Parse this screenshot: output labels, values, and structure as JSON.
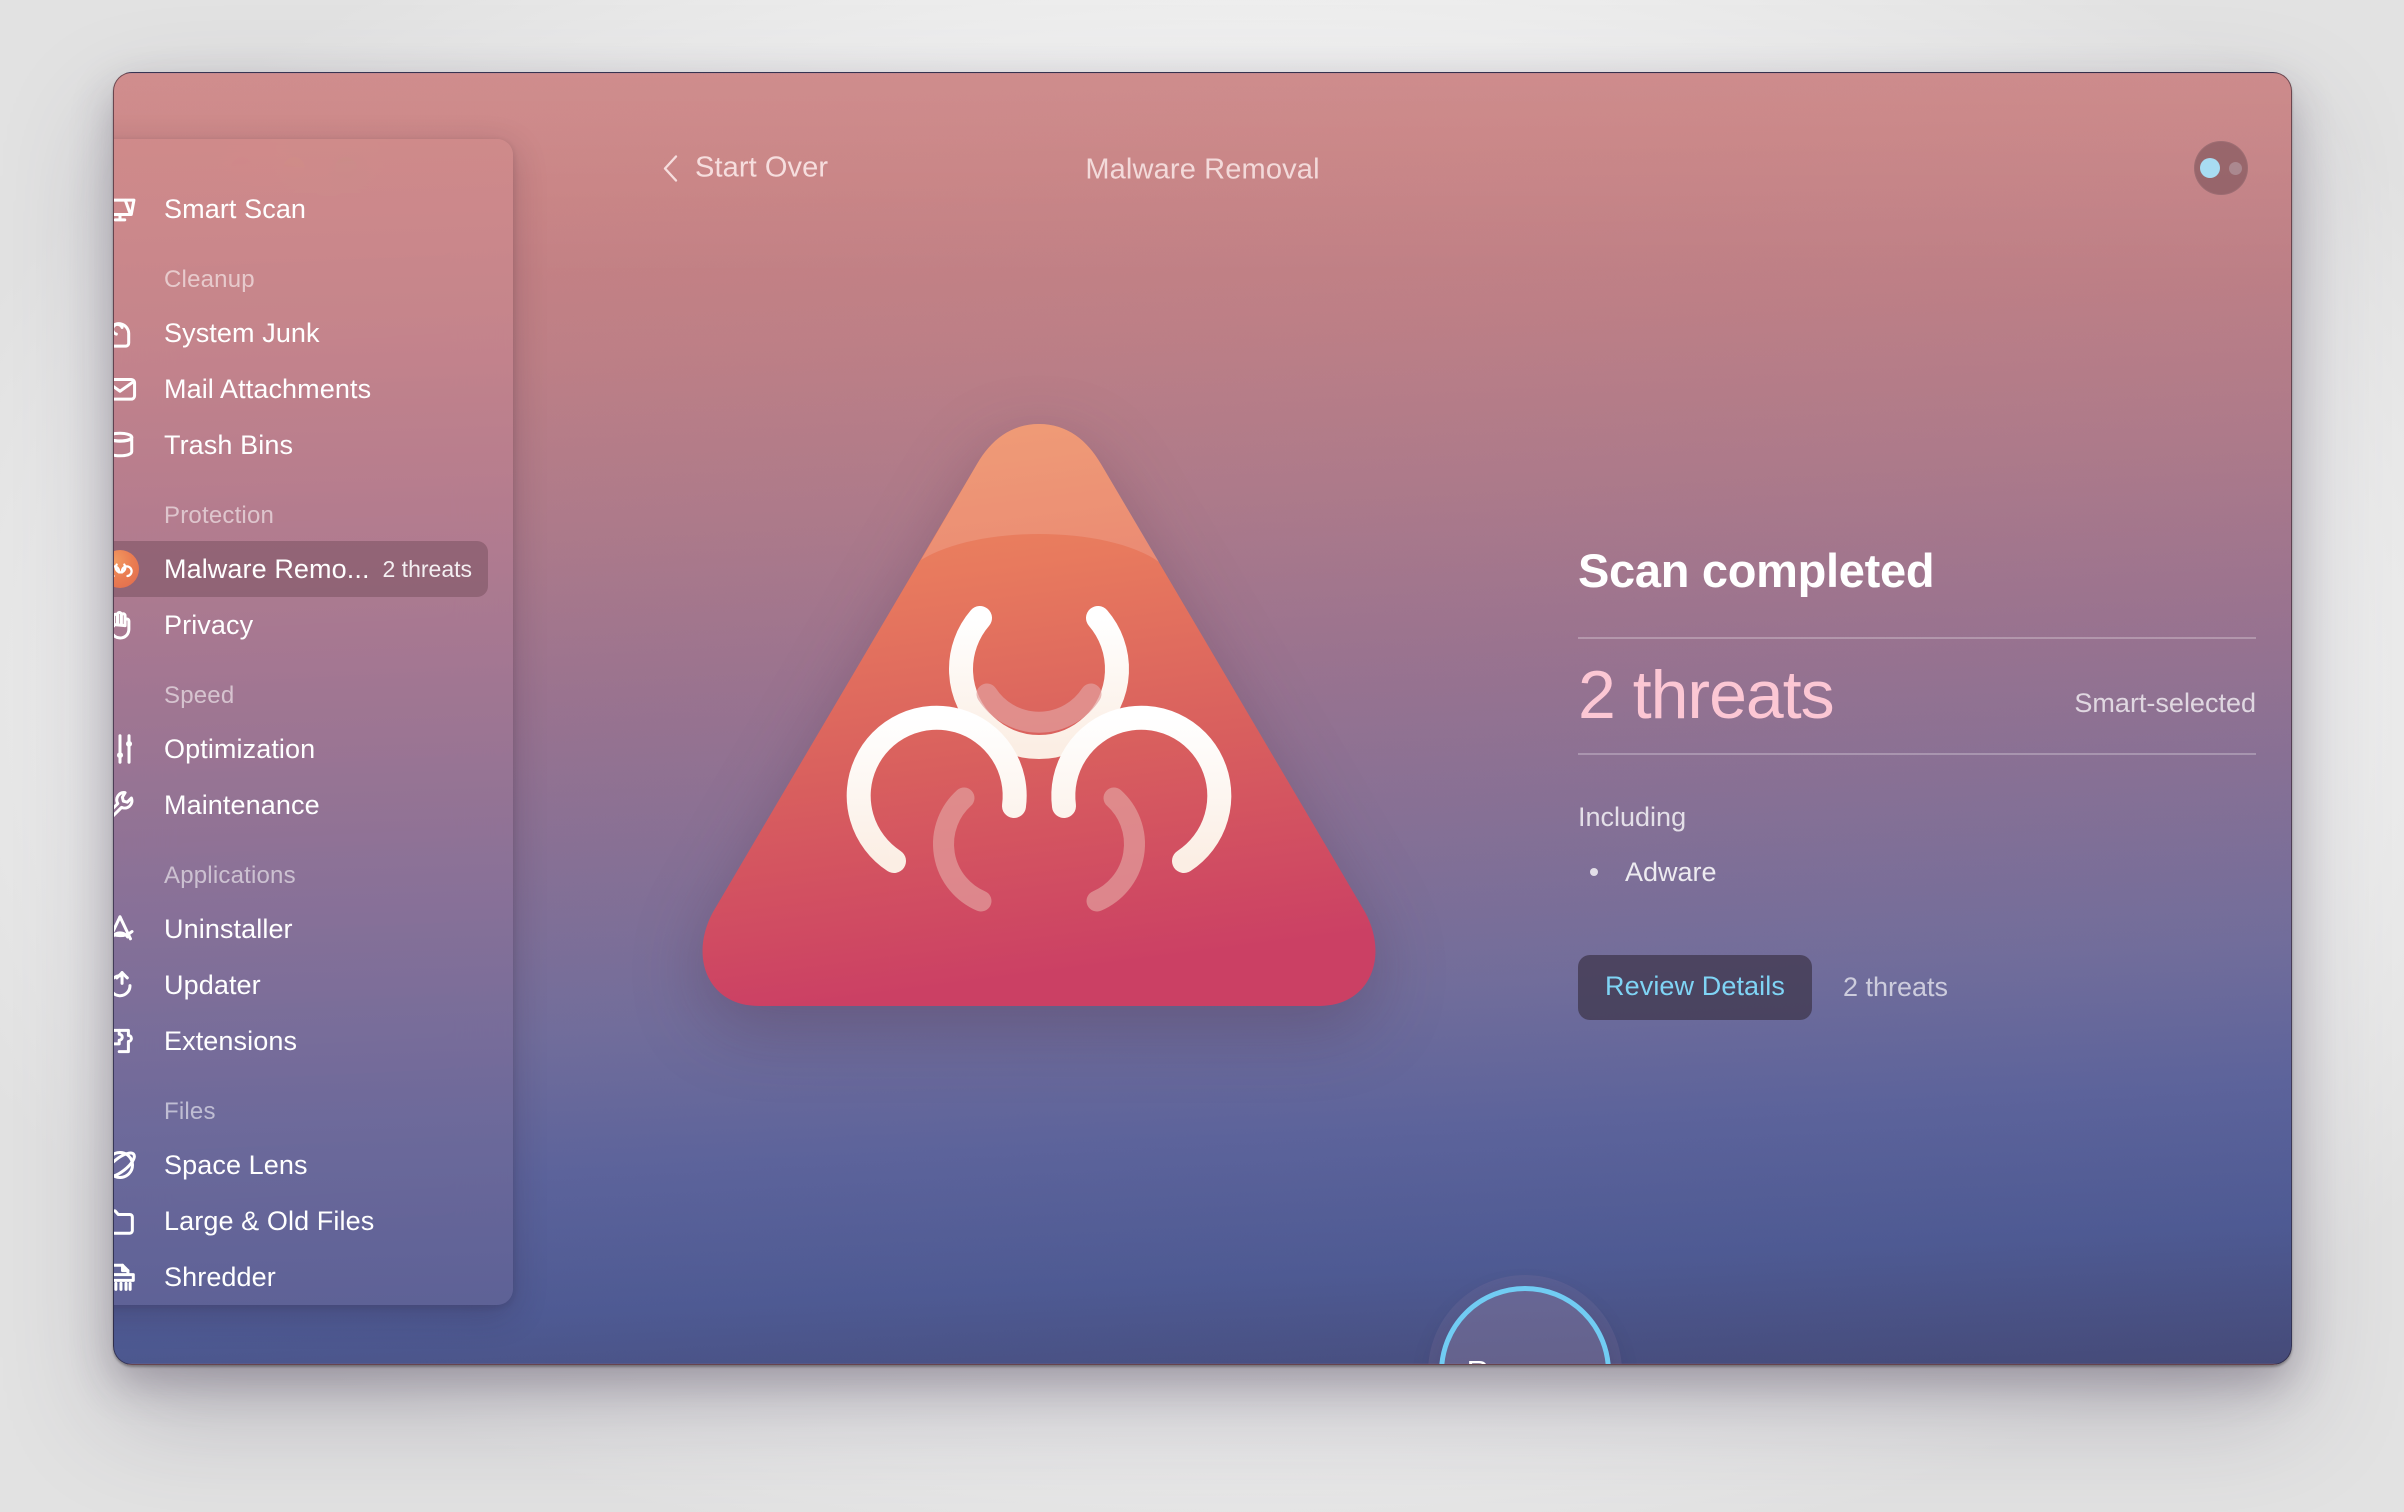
{
  "window": {
    "title": "Malware Removal",
    "back_label": "Start Over",
    "traffic_lights": {
      "close": "close-button",
      "minimize": "minimize-button",
      "maximize": "maximize-button"
    },
    "colors": {
      "accent_blue": "#71ccf3",
      "threat_pink": "#fcc7d4",
      "link_blue": "#7fd4f5",
      "gradient_top": "#cd8585",
      "gradient_bottom": "#454a78",
      "close": "#f8655a",
      "minimize": "#f5be3f",
      "maximize": "#5fc94b"
    }
  },
  "sidebar": {
    "groups": [
      {
        "label": "",
        "items": [
          {
            "label": "Smart Scan",
            "icon": "smart-scan-icon",
            "badge": "",
            "selected": false
          }
        ]
      },
      {
        "label": "Cleanup",
        "items": [
          {
            "label": "System Junk",
            "icon": "system-junk-icon",
            "badge": "",
            "selected": false
          },
          {
            "label": "Mail Attachments",
            "icon": "mail-attachments-icon",
            "badge": "",
            "selected": false
          },
          {
            "label": "Trash Bins",
            "icon": "trash-bins-icon",
            "badge": "",
            "selected": false
          }
        ]
      },
      {
        "label": "Protection",
        "items": [
          {
            "label": "Malware Remo...",
            "icon": "biohazard-icon",
            "badge": "2 threats",
            "selected": true
          },
          {
            "label": "Privacy",
            "icon": "privacy-hand-icon",
            "badge": "",
            "selected": false
          }
        ]
      },
      {
        "label": "Speed",
        "items": [
          {
            "label": "Optimization",
            "icon": "optimization-sliders-icon",
            "badge": "",
            "selected": false
          },
          {
            "label": "Maintenance",
            "icon": "maintenance-wrench-icon",
            "badge": "",
            "selected": false
          }
        ]
      },
      {
        "label": "Applications",
        "items": [
          {
            "label": "Uninstaller",
            "icon": "uninstaller-icon",
            "badge": "",
            "selected": false
          },
          {
            "label": "Updater",
            "icon": "updater-icon",
            "badge": "",
            "selected": false
          },
          {
            "label": "Extensions",
            "icon": "extensions-puzzle-icon",
            "badge": "",
            "selected": false
          }
        ]
      },
      {
        "label": "Files",
        "items": [
          {
            "label": "Space Lens",
            "icon": "space-lens-icon",
            "badge": "",
            "selected": false
          },
          {
            "label": "Large & Old Files",
            "icon": "folder-icon",
            "badge": "",
            "selected": false
          },
          {
            "label": "Shredder",
            "icon": "shredder-icon",
            "badge": "",
            "selected": false
          }
        ]
      }
    ]
  },
  "main": {
    "illustration": "biohazard-triangle-icon",
    "heading": "Scan completed",
    "threat_count": "2 threats",
    "selection_mode": "Smart-selected",
    "including_label": "Including",
    "including_items": [
      "Adware"
    ],
    "review_button": "Review Details",
    "actions_threat_count": "2 threats",
    "remove_button": "Remove"
  }
}
